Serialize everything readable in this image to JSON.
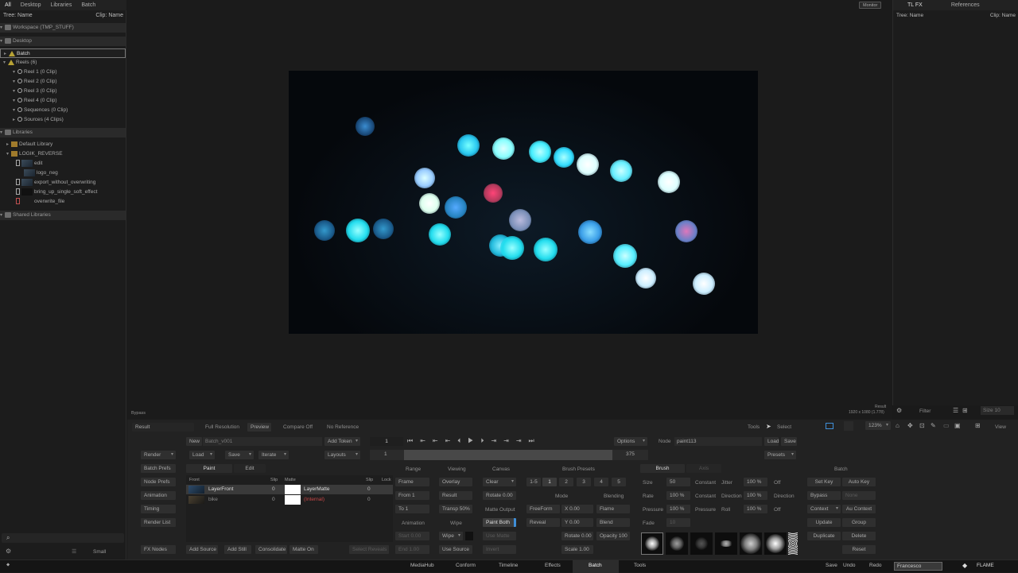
{
  "left_panel": {
    "tabs": [
      "All",
      "Desktop",
      "Libraries",
      "Batch"
    ],
    "header_left": "Tree: Name",
    "header_right": "Clip: Name",
    "tree": [
      {
        "label": "Workspace (TMP_STUFF)"
      },
      {
        "label": "Desktop"
      },
      {
        "label": "Batch"
      },
      {
        "label": "Reels (6)"
      },
      {
        "label": "Reel 1 (0 Clip)"
      },
      {
        "label": "Reel 2 (0 Clip)"
      },
      {
        "label": "Reel 3 (0 Clip)"
      },
      {
        "label": "Reel 4 (0 Clip)"
      },
      {
        "label": "Sequences (0 Clip)"
      },
      {
        "label": "Sources (4 Clips)"
      },
      {
        "label": "Libraries"
      },
      {
        "label": "Default Library"
      },
      {
        "label": "LOGIK_REVERSE"
      },
      {
        "label": "edit"
      },
      {
        "label": "logo_neg"
      },
      {
        "label": "export_without_overwriting"
      },
      {
        "label": "bring_up_single_soft_effect"
      },
      {
        "label": "overwrite_file"
      },
      {
        "label": "Shared Libraries"
      }
    ],
    "view_size": "Small"
  },
  "viewer": {
    "monitor_label": "Monitor",
    "result_label": "Result",
    "resolution_info": "1920 x 1080 (1.778)",
    "bypass_label": "Bypass"
  },
  "right_panel": {
    "tabs": [
      "TL FX",
      "References"
    ],
    "header_left": "Tree: Name",
    "header_right": "Clip: Name"
  },
  "viewer_toolbar": {
    "result": "Result",
    "full_resolution": "Full Resolution",
    "preview": "Preview",
    "compare": "Compare Off",
    "reference": "No Reference",
    "tools": "Tools",
    "select": "Select",
    "zoom": "123%",
    "filter": "Filter",
    "size": "Size 10",
    "view": "View"
  },
  "batch_toolbar": {
    "new": "New",
    "batch_name": "Batch_v001",
    "add_token": "Add Token",
    "frame_num": "1",
    "options": "Options",
    "node_label": "Node",
    "node_name": "paint113",
    "load2": "Load",
    "save2": "Save",
    "render": "Render",
    "load": "Load",
    "save": "Save",
    "iterate": "Iterate",
    "layouts": "Layouts",
    "timeline_start": "1",
    "timeline_end": "375",
    "presets": "Presets"
  },
  "side_buttons": [
    "Batch Prefs",
    "Node Prefs",
    "Animation",
    "Timing",
    "Render List",
    "FX Nodes"
  ],
  "paint_tabs": [
    "Paint",
    "Edit"
  ],
  "layer_list": {
    "col_front": "Front",
    "col_slip": "Slip",
    "col_matte": "Matte",
    "col_slip2": "Slip",
    "col_lock": "Lock",
    "rows": [
      {
        "front": "LayerFront",
        "slip": "0",
        "matte": "LayerMatte",
        "slip2": "0"
      },
      {
        "front": "bike",
        "slip": "0",
        "matte": "(Internal)",
        "slip2": "0"
      }
    ]
  },
  "bottom_buttons": {
    "add_source": "Add Source",
    "add_still": "Add Still",
    "consolidate": "Consolidate",
    "matte_on": "Matte On",
    "select_reveals": "Select Reveals"
  },
  "range": {
    "title": "Range",
    "frame": "Frame",
    "from": "From 1",
    "to": "To 1",
    "animation": "Animation",
    "start": "Start 0.00",
    "end": "End 1.00"
  },
  "viewing": {
    "title": "Viewing",
    "overlay": "Overlay",
    "result": "Result",
    "transp": "Transp 50%",
    "wipe_label": "Wipe",
    "wipe": "Wipe",
    "use_source": "Use Source"
  },
  "canvas": {
    "title": "Canvas",
    "clear": "Clear",
    "rotate": "Rotate 0.00",
    "matte_output": "Matte Output",
    "paint_both": "Paint Both",
    "use_matte": "Use Matte",
    "invert": "Invert"
  },
  "brush_presets": {
    "title": "Brush Presets",
    "slots": [
      "1-5",
      "1",
      "2",
      "3",
      "4",
      "5"
    ],
    "mode_title": "Mode",
    "blending_title": "Blending",
    "freeform": "FreeForm",
    "x": "X 0.00",
    "flame": "Flame",
    "reveal": "Reveal",
    "y": "Y 0.00",
    "blend": "Blend",
    "rotate": "Rotate 0.00",
    "opacity": "Opacity 100",
    "scale": "Scale 1.00"
  },
  "brush": {
    "tab_brush": "Brush",
    "tab_axis": "Axis",
    "size_label": "Size",
    "size_val": "50",
    "rate_label": "Rate",
    "rate_val": "100 %",
    "pressure_label": "Pressure",
    "pressure_val": "100 %",
    "fade_label": "Fade",
    "fade_val": "10",
    "constant1": "Constant",
    "constant2": "Constant",
    "pressure2": "Pressure",
    "jitter": "Jitter",
    "direction": "Direction",
    "roll": "Roll",
    "j_val": "100 %",
    "d_val": "100 %",
    "r_val": "100 %",
    "off1": "Off",
    "direction2": "Direction",
    "off2": "Off"
  },
  "batch_panel": {
    "title": "Batch",
    "set_key": "Set Key",
    "auto_key": "Auto Key",
    "bypass": "Bypass",
    "none": "None",
    "context": "Context",
    "au_context": "Au Context",
    "update": "Update",
    "group": "Group",
    "duplicate": "Duplicate",
    "delete": "Delete",
    "reset": "Reset"
  },
  "status_bar": {
    "tabs": [
      "MediaHub",
      "Conform",
      "Timeline",
      "Effects",
      "Batch",
      "Tools"
    ],
    "active_tab": "Batch",
    "save": "Save",
    "undo": "Undo",
    "redo": "Redo",
    "user": "Francesco",
    "app": "FLAME"
  },
  "colors": {
    "accent": "#3f8fd8",
    "bokeh_cyan": "#5fe6ff",
    "panel": "#222222"
  }
}
